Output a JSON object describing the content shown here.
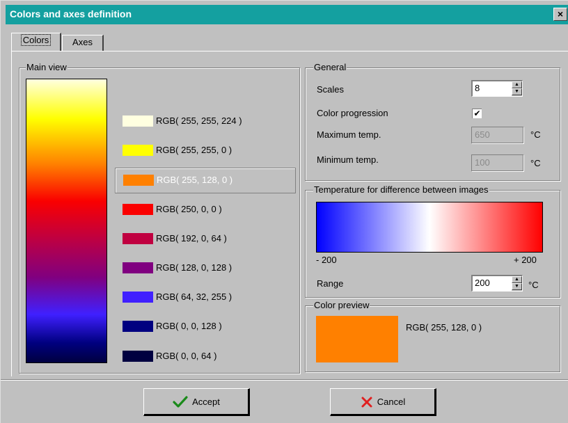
{
  "window": {
    "title": "Colors and axes definition",
    "close_label": "×"
  },
  "tabs": [
    {
      "label": "Colors"
    },
    {
      "label": "Axes"
    }
  ],
  "main_view": {
    "label": "Main view",
    "colors": [
      {
        "text": "RGB( 255, 255, 224 )",
        "color": "#ffffe0"
      },
      {
        "text": "RGB( 255, 255, 0 )",
        "color": "#ffff00"
      },
      {
        "text": "RGB( 255, 128, 0 )",
        "color": "#ff8000",
        "selected": true
      },
      {
        "text": "RGB( 250, 0, 0 )",
        "color": "#fa0000"
      },
      {
        "text": "RGB( 192, 0, 64 )",
        "color": "#c00040"
      },
      {
        "text": "RGB( 128, 0, 128 )",
        "color": "#800080"
      },
      {
        "text": "RGB( 64, 32, 255 )",
        "color": "#4020ff"
      },
      {
        "text": "RGB( 0, 0, 128 )",
        "color": "#000080"
      },
      {
        "text": "RGB( 0, 0, 64 )",
        "color": "#000040"
      }
    ]
  },
  "general": {
    "label": "General",
    "scales_label": "Scales",
    "scales_value": "8",
    "color_progression_label": "Color progression",
    "color_progression_checked": true,
    "max_temp_label": "Maximum temp.",
    "max_temp_value": "650",
    "min_temp_label": "Minimum temp.",
    "min_temp_value": "100",
    "unit": "°C"
  },
  "difference": {
    "label": "Temperature for difference between images",
    "min_label": "- 200",
    "max_label": "+ 200",
    "range_label": "Range",
    "range_value": "200",
    "unit": "°C"
  },
  "preview": {
    "label": "Color preview",
    "text": "RGB( 255, 128, 0 )",
    "color": "#ff8000"
  },
  "buttons": {
    "accept": "Accept",
    "cancel": "Cancel"
  },
  "icons": {
    "accept": "checkmark-icon",
    "cancel": "x-icon"
  }
}
